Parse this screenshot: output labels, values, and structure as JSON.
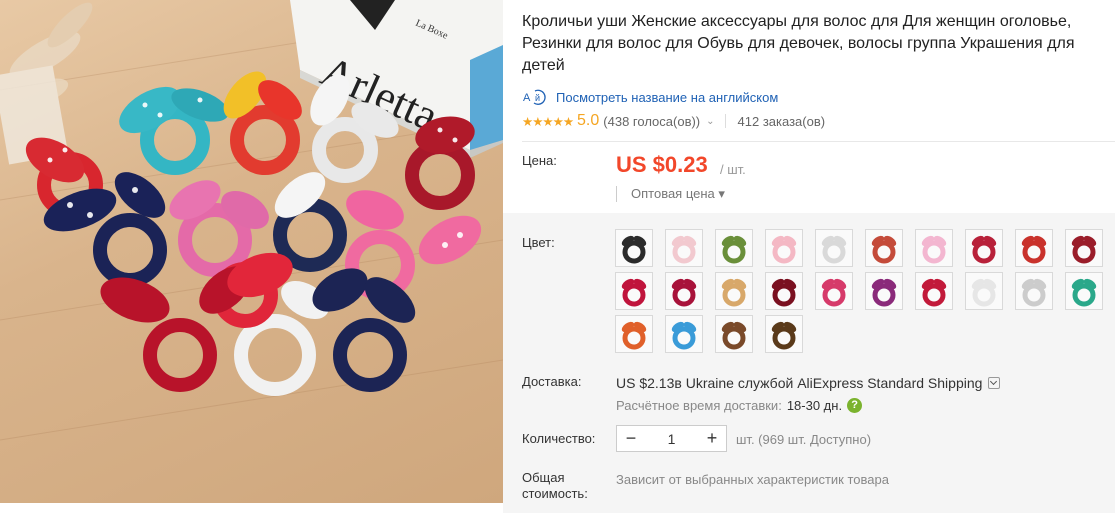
{
  "product": {
    "title": "Кроличьи уши Женские аксессуары для волос для Для женщин оголовье, Резинки для волос для Обувь для девочек, волосы группа Украшения для детей",
    "translate_link": "Посмотреть название на английском",
    "rating_score": "5.0",
    "rating_votes": "(438 голоса(ов))",
    "orders": "412 заказа(ов)",
    "stars": "★★★★★"
  },
  "price": {
    "label": "Цена:",
    "value": "US $0.23",
    "unit": "/ шт.",
    "wholesale": "Оптовая цена ▾"
  },
  "color": {
    "label": "Цвет:",
    "swatch_count": 24,
    "swatch_colors": [
      "#2b2b2b",
      "#f2c9cf",
      "#6a8f3a",
      "#f4b8c4",
      "#d9d9d9",
      "#c44b3a",
      "#f3b6d0",
      "#b8213a",
      "#c9322c",
      "#9a1d2a",
      "#c0143c",
      "#a8123a",
      "#d8a86a",
      "#7a1020",
      "#d63a6a",
      "#8a2a7a",
      "#c21a3a",
      "#e6e6e6",
      "#cccccc",
      "#2aa88a",
      "#e0602a",
      "#3a9bd8",
      "#7a4a2a",
      "#5a3a1a"
    ]
  },
  "shipping": {
    "label": "Доставка:",
    "cost": "US $2.13",
    "text": " в Ukraine службой AliExpress Standard Shipping",
    "est_label": "Расчётное время доставки:",
    "est_days": "18-30 дн."
  },
  "quantity": {
    "label": "Количество:",
    "value": "1",
    "minus": "−",
    "plus": "+",
    "available": "шт. (969 шт. Доступно)"
  },
  "total": {
    "label_line1": "Общая",
    "label_line2": "стоимость:",
    "value": "Зависит от выбранных характеристик товара"
  },
  "photo": {
    "book_text": "Arletta",
    "book_spine": "La Boxe"
  }
}
